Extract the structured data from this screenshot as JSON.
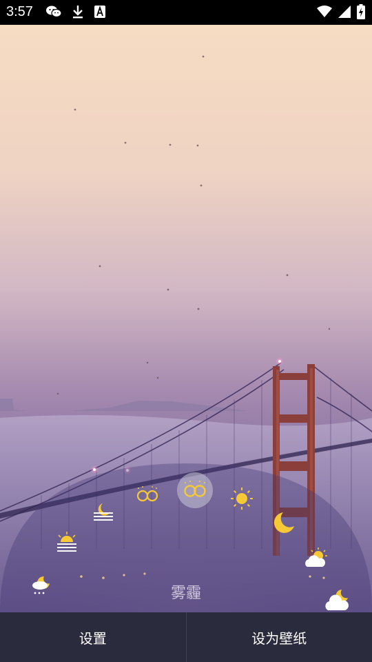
{
  "status_bar": {
    "time": "3:57",
    "icons_left": [
      "wechat-icon",
      "download-icon",
      "font-a-icon"
    ],
    "icons_right": [
      "wifi-icon",
      "signal-icon",
      "battery-charging-icon"
    ]
  },
  "weather_picker": {
    "selected_label": "雾霾",
    "icons": [
      "snow-moon-icon",
      "sunrise-haze-icon",
      "moon-haze-icon",
      "haze-icon",
      "haze-selected-icon",
      "sun-icon",
      "moon-icon",
      "cloud-sun-icon",
      "cloud-moon-icon"
    ]
  },
  "bottom_bar": {
    "settings_label": "设置",
    "set_wallpaper_label": "设为壁纸"
  },
  "colors": {
    "accent_yellow": "#f7c935",
    "bottom_bar_bg": "#2a2b3c"
  }
}
